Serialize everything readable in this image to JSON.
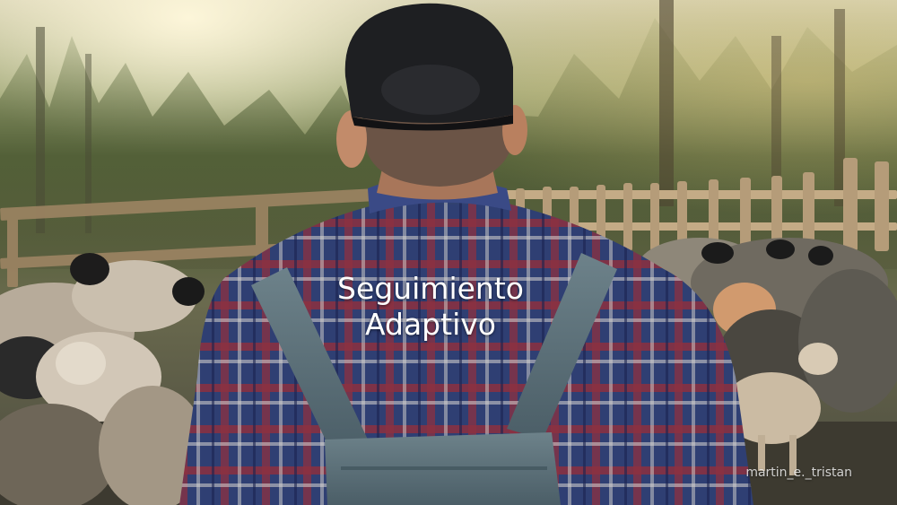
{
  "overlay": {
    "caption_line1": "Seguimiento",
    "caption_line2": "Adaptivo",
    "watermark": "martin_e._tristan"
  },
  "scene": {
    "subject": "farmer-from-behind",
    "colors": {
      "shirt_blue": "#2f3f73",
      "shirt_red": "#8c3040",
      "overalls": "#5b6f78",
      "cap": "#1e1f22",
      "wool": "#cfc2b0",
      "fence": "#b59c79"
    }
  }
}
